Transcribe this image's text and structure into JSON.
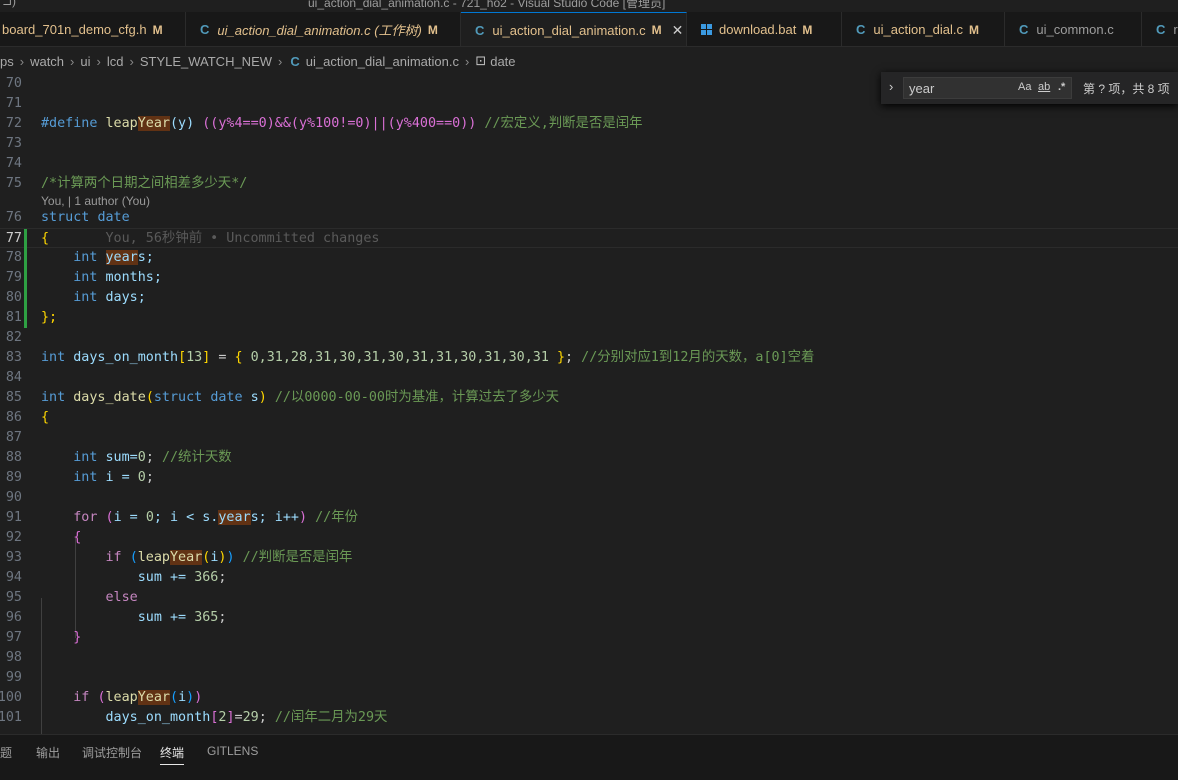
{
  "window_title": "ui_action_dial_animation.c - 721_ho2 - Visual Studio Code [管理员]",
  "tabs": [
    {
      "label": "board_701n_demo_cfg.h",
      "badge": "M"
    },
    {
      "label": "ui_action_dial_animation.c (工作树)",
      "badge": "M"
    },
    {
      "label": "ui_action_dial_animation.c",
      "badge": "M",
      "close": "✕"
    },
    {
      "label": "download.bat",
      "badge": "M"
    },
    {
      "label": "ui_action_dial.c",
      "badge": "M"
    },
    {
      "label": "ui_common.c"
    },
    {
      "label": "r"
    }
  ],
  "breadcrumb": [
    "ps",
    "watch",
    "ui",
    "lcd",
    "STYLE_WATCH_NEW",
    "ui_action_dial_animation.c",
    "date"
  ],
  "find": {
    "value": "year",
    "opt_case": "Aa",
    "opt_word": "ab",
    "opt_regex": ".*",
    "result": "第 ? 项，共 8 项"
  },
  "line_numbers": [
    "70",
    "71",
    "72",
    "73",
    "74",
    "75",
    "76",
    "77",
    "78",
    "79",
    "80",
    "81",
    "82",
    "83",
    "84",
    "85",
    "86",
    "87",
    "88",
    "89",
    "90",
    "91",
    "92",
    "93",
    "94",
    "95",
    "96",
    "97",
    "98",
    "99",
    "100",
    "101"
  ],
  "codelens": "You, | 1 author (You)",
  "blame": "You, 56秒钟前 • Uncommitted changes",
  "code": {
    "l72_a": "#define",
    "l72_b": "leap",
    "l72_c": "Year",
    "l72_d": "(y)",
    "l72_e": "((y%4==0)&&(y%100!=0)||(y%400==0))",
    "l72_cm": "//宏定义,判断是否是闰年",
    "l75_cm": "/*计算两个日期之间相差多少天*/",
    "l76_kw": "struct",
    "l76_name": "date",
    "l77": "{",
    "int": "int",
    "l78_a": "year",
    "l78_b": "s;",
    "l79": "months;",
    "l80": "days;",
    "l81": "};",
    "l83_name": "days_on_month",
    "l83_size": "13",
    "l83_vals": "0,31,28,31,30,31,30,31,31,30,31,30,31",
    "l83_cm": "//分别对应1到12月的天数，a[0]空着",
    "l85_fn": "days_date",
    "l85_kw": "struct",
    "l85_ty": "date",
    "l85_p": "s",
    "l85_cm": "//以0000-00-00时为基准，计算过去了多少天",
    "l86": "{",
    "l88_a": "sum=",
    "l88_n": "0",
    "l88_cm": "//统计天数",
    "l89_a": "i = ",
    "l89_n": "0",
    "l91_kw": "for",
    "l91_a": "i = ",
    "l91_n": "0",
    "l91_b": "; i < s.",
    "l91_c": "year",
    "l91_d": "s; i++",
    "l91_cm": "//年份",
    "l92": "{",
    "l93_kw": "if",
    "l93_a": "leap",
    "l93_b": "Year",
    "l93_c": "i",
    "l93_cm": "//判断是否是闰年",
    "l94_a": "sum += ",
    "l94_n": "366",
    "l95": "else",
    "l96_a": "sum += ",
    "l96_n": "365",
    "l97": "}",
    "l100_kw": "if",
    "l100_a": "leap",
    "l100_b": "Year",
    "l100_c": "i",
    "l101_a": "days_on_month",
    "l101_i": "2",
    "l101_b": "=",
    "l101_n": "29",
    "l101_cm": "//闰年二月为29天"
  },
  "panel_tabs": [
    "题",
    "输出",
    "调试控制台",
    "终端",
    "GITLENS"
  ]
}
